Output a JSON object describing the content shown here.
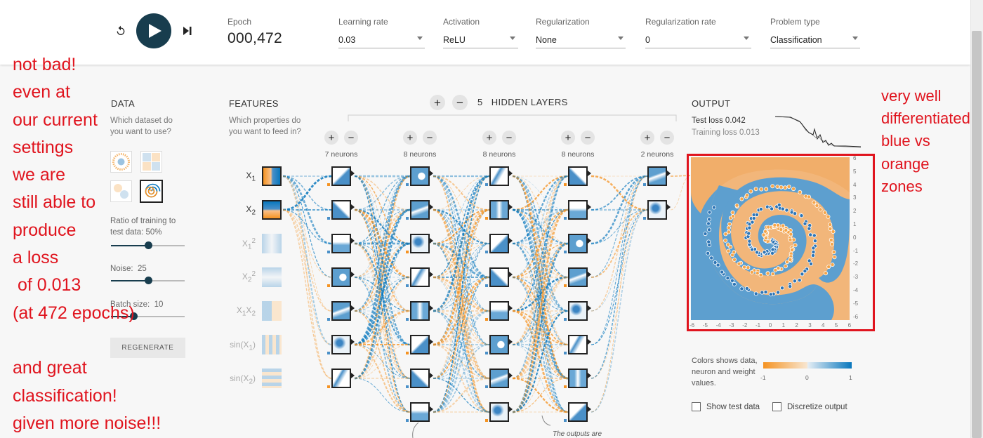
{
  "toolbar": {
    "epoch_label": "Epoch",
    "epoch_value": "000,472",
    "learning_rate": {
      "label": "Learning rate",
      "value": "0.03"
    },
    "activation": {
      "label": "Activation",
      "value": "ReLU"
    },
    "regularization": {
      "label": "Regularization",
      "value": "None"
    },
    "regularization_rate": {
      "label": "Regularization rate",
      "value": "0"
    },
    "problem_type": {
      "label": "Problem type",
      "value": "Classification"
    }
  },
  "data_panel": {
    "title": "DATA",
    "subtitle": "Which dataset do you want to use?",
    "ratio_label": "Ratio of training to test data:",
    "ratio_value": "50%",
    "ratio_fraction": 0.5,
    "noise_label": "Noise:",
    "noise_value": "25",
    "noise_fraction": 0.5,
    "batch_label": "Batch size:",
    "batch_value": "10",
    "batch_fraction": 0.3,
    "regenerate_label": "REGENERATE"
  },
  "features": {
    "title": "FEATURES",
    "subtitle": "Which properties do you want to feed in?",
    "items": [
      "X1",
      "X2",
      "X1²",
      "X2²",
      "X1X2",
      "sin(X1)",
      "sin(X2)"
    ]
  },
  "network": {
    "hidden_layers_count": "5",
    "hidden_layers_label": "HIDDEN LAYERS",
    "layers": [
      {
        "neurons_label": "7 neurons",
        "count": 7
      },
      {
        "neurons_label": "8 neurons",
        "count": 8
      },
      {
        "neurons_label": "8 neurons",
        "count": 8
      },
      {
        "neurons_label": "8 neurons",
        "count": 8
      },
      {
        "neurons_label": "2 neurons",
        "count": 2
      }
    ],
    "caption": "The outputs are"
  },
  "output": {
    "title": "OUTPUT",
    "test_loss": "Test loss 0.042",
    "training_loss": "Training loss 0.013",
    "x_ticks": [
      "-6",
      "-5",
      "-4",
      "-3",
      "-2",
      "-1",
      "0",
      "1",
      "2",
      "3",
      "4",
      "5",
      "6"
    ],
    "y_ticks": [
      "6",
      "5",
      "4",
      "3",
      "2",
      "1",
      "0",
      "-1",
      "-2",
      "-3",
      "-4",
      "-5",
      "-6"
    ],
    "legend_text": "Colors shows data, neuron and weight values.",
    "legend_min": "-1",
    "legend_mid": "0",
    "legend_max": "1",
    "show_test_data": "Show test data",
    "discretize_output": "Discretize output"
  },
  "colors": {
    "orange": "#f59322",
    "blue": "#0877bd",
    "dark": "#183d4e",
    "annotation_red": "#e0141e"
  },
  "annotations": {
    "left_lines": [
      "not bad!",
      "even at",
      "our current",
      "settings",
      "we are",
      "still able to",
      "produce",
      "a loss",
      " of 0.013",
      "(at 472 epochs)",
      "",
      "and great",
      "classification!",
      "given more noise!!!"
    ],
    "right_lines": [
      "very well",
      "differentiated",
      "blue vs",
      "orange",
      "zones"
    ]
  }
}
